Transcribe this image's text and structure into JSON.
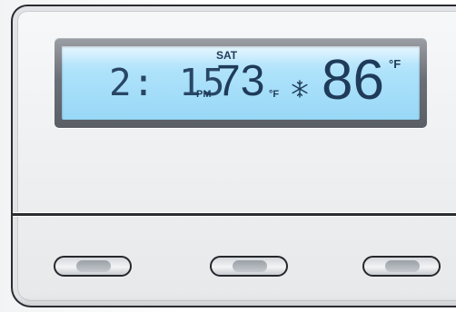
{
  "display": {
    "time": "2: 15",
    "ampm": "PM",
    "day": "SAT",
    "current_temp": "73",
    "current_unit": "°F",
    "set_temp": "86",
    "set_unit": "°F",
    "mode_icon": "snowflake-icon"
  },
  "buttons": [
    {
      "name": "left-button",
      "icon": "pill-button"
    },
    {
      "name": "middle-button",
      "icon": "pill-button"
    },
    {
      "name": "right-button",
      "icon": "pill-button"
    }
  ],
  "colors": {
    "lcd_background": "#aee2fb",
    "lcd_text": "#1f3b59",
    "body": "#eeeff1",
    "outline": "#2a2c31"
  }
}
